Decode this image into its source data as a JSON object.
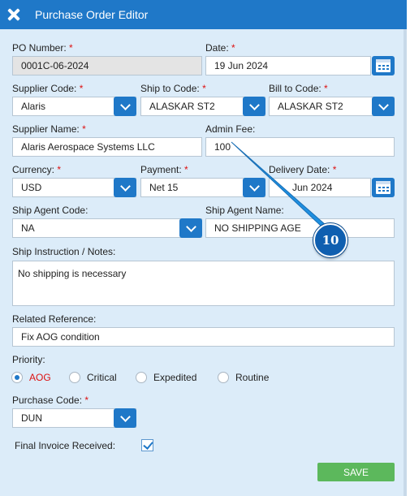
{
  "window": {
    "title": "Purchase Order Editor"
  },
  "form": {
    "po_number": {
      "label": "PO Number:",
      "required": "*",
      "value": "0001C-06-2024"
    },
    "date": {
      "label": "Date:",
      "required": "*",
      "value": "19 Jun 2024"
    },
    "supplier_code": {
      "label": "Supplier Code:",
      "required": "*",
      "value": "Alaris"
    },
    "ship_to_code": {
      "label": "Ship to Code:",
      "required": "*",
      "value": "ALASKAR ST2"
    },
    "bill_to_code": {
      "label": "Bill to Code:",
      "required": "*",
      "value": "ALASKAR ST2"
    },
    "supplier_name": {
      "label": "Supplier Name:",
      "required": "*",
      "value": "Alaris Aerospace Systems LLC"
    },
    "admin_fee": {
      "label": "Admin Fee:",
      "value": "100"
    },
    "currency": {
      "label": "Currency:",
      "required": "*",
      "value": "USD"
    },
    "payment": {
      "label": "Payment:",
      "required": "*",
      "value": "Net 15"
    },
    "delivery_date": {
      "label": "Delivery Date:",
      "required": "*",
      "value": "Jun 2024"
    },
    "ship_agent_code": {
      "label": "Ship Agent Code:",
      "value": "NA"
    },
    "ship_agent_name": {
      "label": "Ship Agent Name:",
      "value": "NO SHIPPING AGE"
    },
    "ship_instruction": {
      "label": "Ship Instruction / Notes:",
      "value": "No shipping is necessary"
    },
    "related_reference": {
      "label": "Related Reference:",
      "value": "Fix AOG condition"
    },
    "priority": {
      "label": "Priority:",
      "options": [
        "AOG",
        "Critical",
        "Expedited",
        "Routine"
      ],
      "selected": "AOG"
    },
    "purchase_code": {
      "label": "Purchase Code:",
      "required": "*",
      "value": "DUN"
    },
    "final_invoice": {
      "label": "Final Invoice Received:",
      "checked": true
    }
  },
  "actions": {
    "save_label": "SAVE"
  },
  "annotation": {
    "number": "10"
  },
  "colors": {
    "accent": "#1f78c8",
    "required": "#dd1111",
    "save": "#5cb85c",
    "panel": "#dcecf9"
  },
  "icons": {
    "close": "close-icon",
    "calendar": "calendar-icon",
    "dropdown": "chevron-down-icon",
    "check": "check-icon"
  }
}
